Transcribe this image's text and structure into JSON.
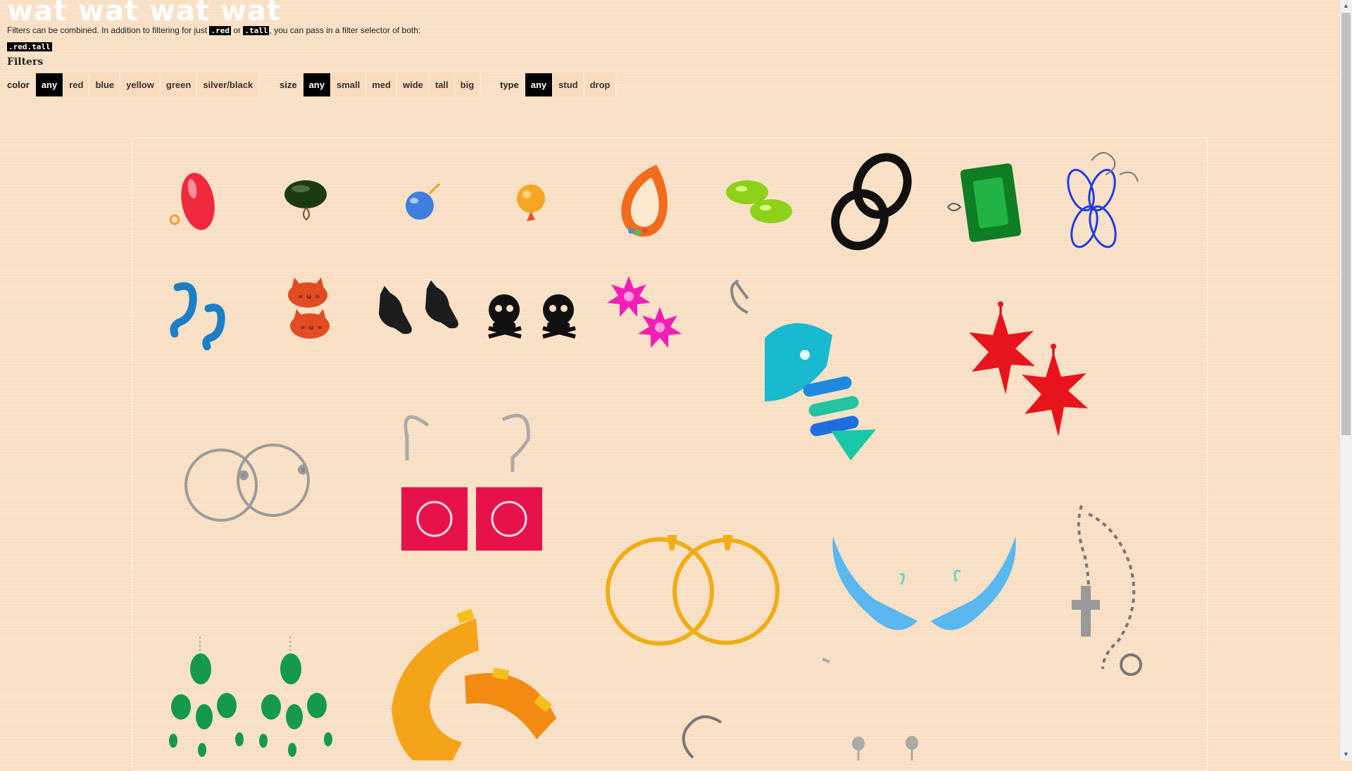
{
  "page": {
    "title": "wat wat wat wat",
    "intro": {
      "part1": "Filters can be combined. In addition to filtering for just ",
      "code_red": ".red",
      "part2": " or ",
      "code_tall": ".tall",
      "part3": ", you can pass in a filter selector of both:",
      "combined_code": ".red.tall"
    },
    "filters_heading": "Filters"
  },
  "filters": {
    "color": {
      "label": "color",
      "options": [
        "any",
        "red",
        "blue",
        "yellow",
        "green",
        "silver/black"
      ],
      "selected": "any"
    },
    "size": {
      "label": "size",
      "options": [
        "any",
        "small",
        "med",
        "wide",
        "tall",
        "big"
      ],
      "selected": "any"
    },
    "type": {
      "label": "type",
      "options": [
        "any",
        "stud",
        "drop"
      ],
      "selected": "any"
    }
  },
  "gallery": {
    "items": [
      "red-oval-stud-earrings",
      "dark-green-stud-earrings",
      "blue-drop-earrings",
      "orange-round-stud-earrings",
      "rainbow-crescent-earring",
      "lime-green-lemon-earrings",
      "black-ring-earrings",
      "green-gem-stud-earring",
      "blue-wire-flower-earring",
      "blue-seahorse-earrings",
      "orange-cat-face-earrings",
      "black-cat-earrings",
      "skull-crossbones-earrings",
      "magenta-flower-earrings",
      "teal-fish-skeleton-earring",
      "red-maple-leaf-earrings",
      "silver-hoop-earrings",
      "red-snowflake-drop-earrings",
      "gold-hoop-earrings",
      "blue-wing-earrings",
      "silver-cross-chain-earring",
      "green-emerald-chandelier-earrings",
      "orange-sun-spiral-earring",
      "silver-hook-earring",
      "silver-bead-drop-earrings"
    ]
  },
  "colors": {
    "background": "#f8dfc3",
    "active_button_bg": "#000000",
    "title_color": "#ffffff"
  }
}
